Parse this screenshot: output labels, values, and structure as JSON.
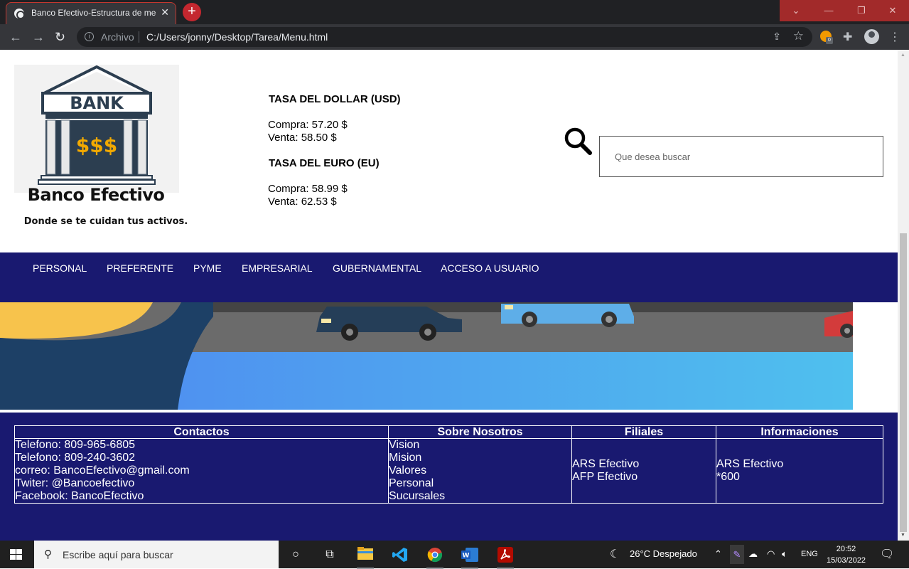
{
  "browser": {
    "tab_title": "Banco Efectivo-Estructura de me",
    "tab_close": "✕",
    "new_tab": "+",
    "window_controls": [
      "⌄",
      "—",
      "❐",
      "✕"
    ],
    "nav": {
      "back": "←",
      "forward": "→",
      "reload": "↻"
    },
    "scheme_label": "Archivo",
    "url": "C:/Users/jonny/Desktop/Tarea/Menu.html",
    "extension_badge": "0",
    "accent_color": "#c4272f"
  },
  "header": {
    "logo_bank_text": "BANK",
    "logo_money_text": "$$$",
    "bank_name": "Banco Efectivo",
    "slogan": "Donde se te cuidan tus activos."
  },
  "rates": {
    "usd": {
      "title": "TASA DEL DOLLAR (USD)",
      "compra": "Compra: 57.20 $",
      "venta": "Venta: 58.50 $"
    },
    "eur": {
      "title": "TASA DEL EURO (EU)",
      "compra": "Compra: 58.99 $",
      "venta": "Venta: 62.53 $"
    }
  },
  "search": {
    "placeholder": "Que desea buscar"
  },
  "menu": [
    "PERSONAL",
    "PREFERENTE",
    "PYME",
    "EMPRESARIAL",
    "GUBERNAMENTAL",
    "ACCESO A USUARIO"
  ],
  "colors": {
    "primary": "#191970",
    "banner_blue": "#4a8cf0",
    "banner_road": "#6b6b6b"
  },
  "footer": {
    "headers": [
      "Contactos",
      "Sobre Nosotros",
      "Filiales",
      "Informaciones"
    ],
    "contactos": [
      "Telefono: 809-965-6805",
      "Telefono: 809-240-3602",
      "correo: BancoEfectivo@gmail.com",
      "Twiter: @Bancoefectivo",
      "Facebook: BancoEfectivo"
    ],
    "sobre_nosotros": [
      "Vision",
      "Mision",
      "Valores",
      "Personal",
      "Sucursales"
    ],
    "filiales": [
      "ARS Efectivo",
      "AFP Efectivo"
    ],
    "informaciones": [
      "ARS Efectivo",
      "*600"
    ]
  },
  "taskbar": {
    "search_placeholder": "Escribe aquí para buscar",
    "weather": "26°C  Despejado",
    "language": "ENG",
    "time": "20:52",
    "date": "15/03/2022",
    "apps": [
      "task-view",
      "file-explorer",
      "vscode",
      "chrome",
      "word",
      "acrobat"
    ]
  }
}
